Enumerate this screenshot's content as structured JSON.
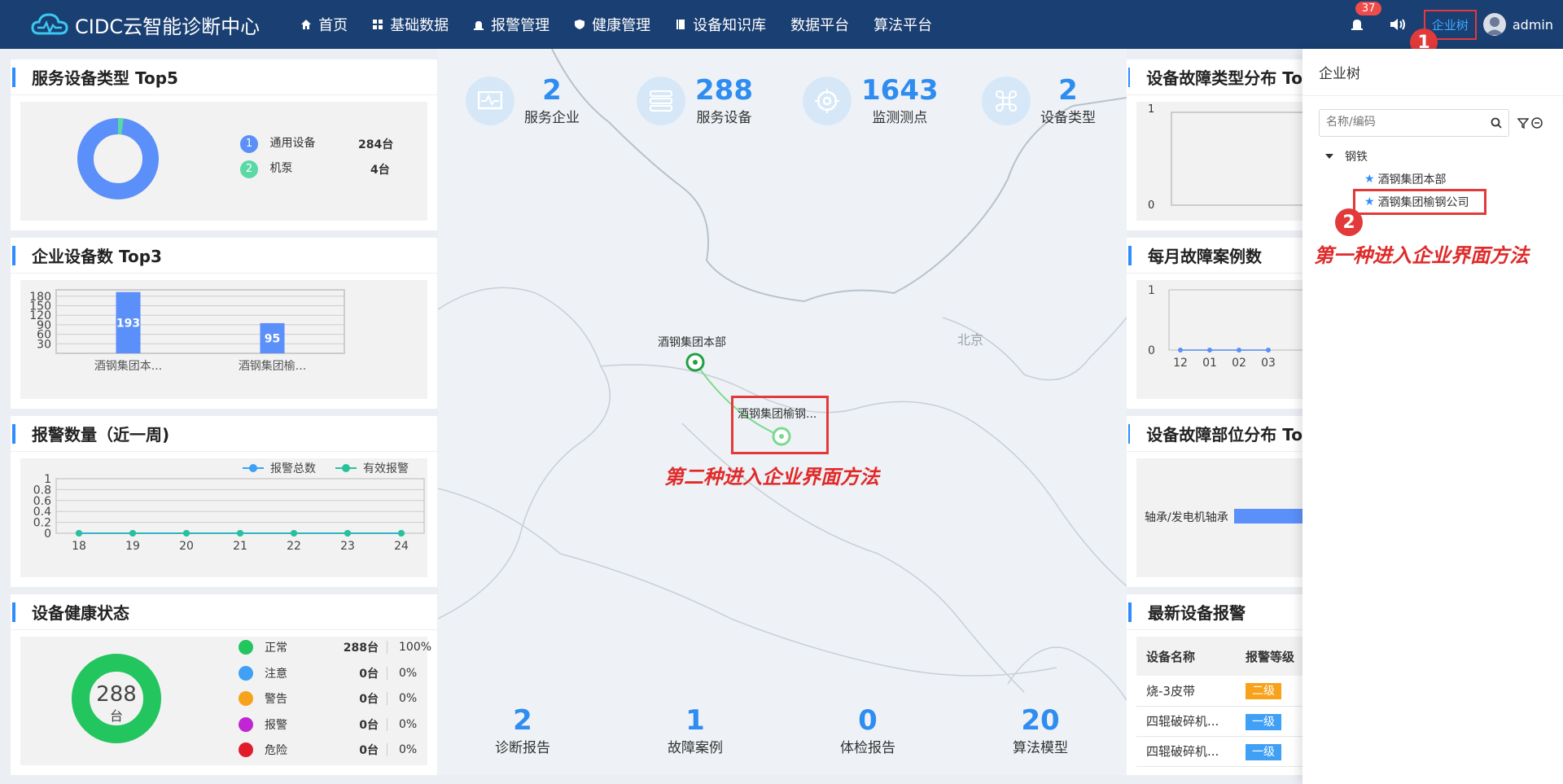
{
  "app": {
    "title": "CIDC云智能诊断中心"
  },
  "nav": [
    {
      "label": "首页",
      "icon": "home-icon"
    },
    {
      "label": "基础数据",
      "icon": "grid-icon"
    },
    {
      "label": "报警管理",
      "icon": "alarm-icon"
    },
    {
      "label": "健康管理",
      "icon": "shield-icon"
    },
    {
      "label": "设备知识库",
      "icon": "book-icon"
    },
    {
      "label": "数据平台",
      "icon": ""
    },
    {
      "label": "算法平台",
      "icon": ""
    }
  ],
  "topbar": {
    "bell_count": "37",
    "tree_button": "企业树",
    "user_name": "admin"
  },
  "service_top5": {
    "title": "服务设备类型 Top5",
    "items": [
      {
        "rank": "1",
        "name": "通用设备",
        "value": "284台",
        "color": "#5b8ff9"
      },
      {
        "rank": "2",
        "name": "机泵",
        "value": "4台",
        "color": "#5ad8a6"
      }
    ]
  },
  "enterprise_top3": {
    "title": "企业设备数 Top3",
    "chart_data": {
      "type": "bar",
      "categories": [
        "酒钢集团本...",
        "酒钢集团榆..."
      ],
      "values": [
        193,
        95
      ],
      "yticks": [
        "180",
        "150",
        "120",
        "90",
        "60",
        "30"
      ],
      "ylim": [
        0,
        200
      ]
    }
  },
  "alarm_week": {
    "title": "报警数量（近一周)",
    "chart_data": {
      "type": "line",
      "x": [
        "18",
        "19",
        "20",
        "21",
        "22",
        "23",
        "24"
      ],
      "series": [
        {
          "name": "报警总数",
          "values": [
            0,
            0,
            0,
            0,
            0,
            0,
            0
          ],
          "color": "#3fa0f5"
        },
        {
          "name": "有效报警",
          "values": [
            0,
            0,
            0,
            0,
            0,
            0,
            0
          ],
          "color": "#26c39a"
        }
      ],
      "yticks": [
        "1",
        "0.8",
        "0.6",
        "0.4",
        "0.2",
        "0"
      ],
      "ylim": [
        0,
        1
      ]
    }
  },
  "health": {
    "title": "设备健康状态",
    "total": "288",
    "unit": "台",
    "rows": [
      {
        "label": "正常",
        "count": "288台",
        "pct": "100%",
        "color": "#22c55e"
      },
      {
        "label": "注意",
        "count": "0台",
        "pct": "0%",
        "color": "#3fa0f5"
      },
      {
        "label": "警告",
        "count": "0台",
        "pct": "0%",
        "color": "#f7a21b"
      },
      {
        "label": "报警",
        "count": "0台",
        "pct": "0%",
        "color": "#c026d3"
      },
      {
        "label": "危险",
        "count": "0台",
        "pct": "0%",
        "color": "#e11d2b"
      }
    ]
  },
  "top_stats": [
    {
      "value": "2",
      "label": "服务企业"
    },
    {
      "value": "288",
      "label": "服务设备"
    },
    {
      "value": "1643",
      "label": "监测测点"
    },
    {
      "value": "2",
      "label": "设备类型"
    }
  ],
  "bottom_stats": [
    {
      "value": "2",
      "label": "诊断报告"
    },
    {
      "value": "1",
      "label": "故障案例"
    },
    {
      "value": "0",
      "label": "体检报告"
    },
    {
      "value": "20",
      "label": "算法模型"
    }
  ],
  "map": {
    "city_label": "北京",
    "site1_label": "酒钢集团本部",
    "site2_label": "酒钢集团榆钢...",
    "annotation_2nd": "第二种进入企业界面方法"
  },
  "fault_type": {
    "title": "设备故障类型分布 To",
    "yticks": [
      "1",
      "0"
    ]
  },
  "monthly_fault": {
    "title": "每月故障案例数",
    "chart_data": {
      "type": "line",
      "x": [
        "12",
        "01",
        "02",
        "03"
      ],
      "values": [
        0,
        0,
        0,
        0
      ],
      "yticks": [
        "1",
        "0"
      ]
    }
  },
  "fault_part": {
    "title": "设备故障部位分布 To",
    "label": "轴承/发电机轴承"
  },
  "latest_alarm": {
    "title": "最新设备报警",
    "columns": [
      "设备名称",
      "报警等级"
    ],
    "rows": [
      {
        "name": "烧-3皮带",
        "level": "二级",
        "color": "#f7a21b"
      },
      {
        "name": "四辊破碎机...",
        "level": "一级",
        "color": "#3fa0f5"
      },
      {
        "name": "四辊破碎机...",
        "level": "一级",
        "color": "#3fa0f5"
      }
    ]
  },
  "tree_panel": {
    "title": "企业树",
    "search_placeholder": "名称/编码",
    "group": "钢铁",
    "nodes": [
      "酒钢集团本部",
      "酒钢集团榆钢公司"
    ],
    "annotation_1st": "第一种进入企业界面方法",
    "badge1": "1",
    "badge2": "2"
  }
}
